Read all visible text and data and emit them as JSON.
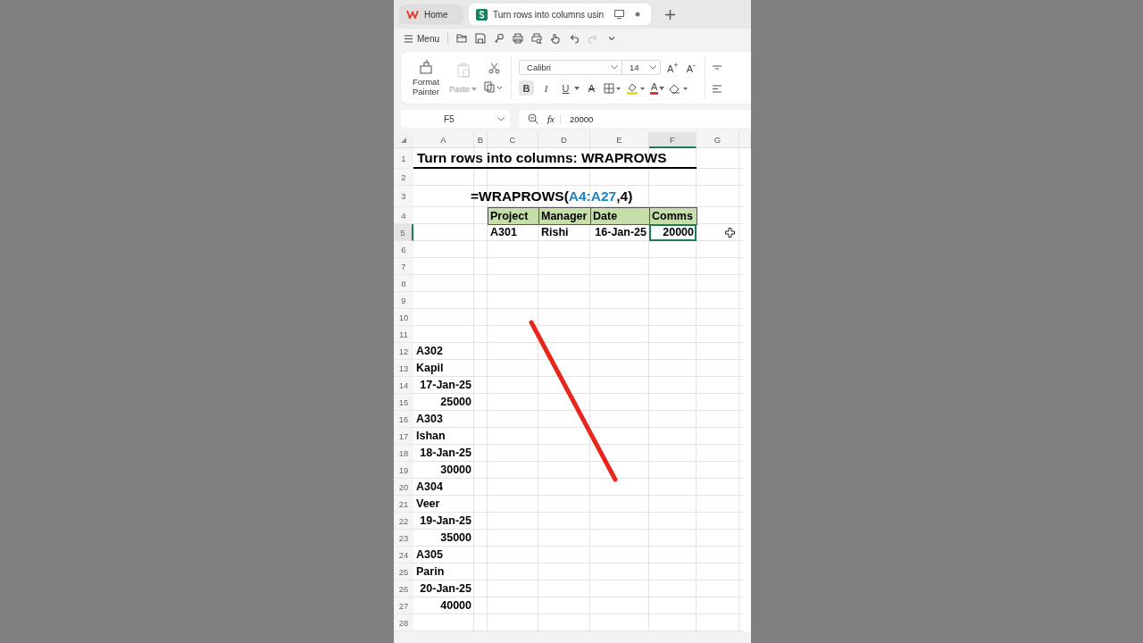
{
  "tabs": [
    {
      "label": "Home",
      "kind": "home",
      "selected": false
    },
    {
      "label": "Turn rows into columns usin",
      "kind": "sheet",
      "selected": true
    }
  ],
  "menu": {
    "label": "Menu"
  },
  "quick_tools": [
    {
      "kind": "open",
      "disabled": false
    },
    {
      "kind": "save",
      "disabled": false
    },
    {
      "kind": "key",
      "disabled": false
    },
    {
      "kind": "print",
      "disabled": false
    },
    {
      "kind": "preview",
      "disabled": false
    },
    {
      "kind": "hand",
      "disabled": false
    },
    {
      "kind": "undo",
      "disabled": false
    },
    {
      "kind": "redo",
      "disabled": true
    },
    {
      "kind": "more",
      "disabled": false
    }
  ],
  "ribbon": {
    "format_painter": "Format Painter",
    "paste": {
      "label": "Paste",
      "disabled": true
    },
    "font": "Calibri",
    "size": "14",
    "grow_font": "A$^{+}$",
    "shrink_font": "A$^{-}$",
    "format_buttons": [
      {
        "label": "B",
        "kind": "bold",
        "selected": true
      },
      {
        "label": "I",
        "kind": "italic",
        "selected": false
      },
      {
        "label": "U",
        "kind": "underline",
        "selected": false
      },
      {
        "label": "A",
        "kind": "strike",
        "selected": false
      }
    ],
    "font_color": {
      "label": "A",
      "color": "#e03030"
    },
    "fill_color": {
      "color": "#f5e000"
    }
  },
  "formula_bar": {
    "name_box": "F5",
    "fx": "fx",
    "value": "20000"
  },
  "sheet": {
    "columns": [
      {
        "label": "A",
        "selected": false
      },
      {
        "label": "B",
        "selected": false
      },
      {
        "label": "C",
        "selected": false
      },
      {
        "label": "D",
        "selected": false
      },
      {
        "label": "E",
        "selected": false
      },
      {
        "label": "F",
        "selected": true
      },
      {
        "label": "G",
        "selected": false
      }
    ],
    "rows": [
      {
        "label": "1",
        "selected": false
      },
      {
        "label": "2",
        "selected": false
      },
      {
        "label": "3",
        "selected": false
      },
      {
        "label": "4",
        "selected": false
      },
      {
        "label": "5",
        "selected": true
      },
      {
        "label": "6",
        "selected": false
      },
      {
        "label": "7",
        "selected": false
      },
      {
        "label": "8",
        "selected": false
      },
      {
        "label": "9",
        "selected": false
      },
      {
        "label": "10",
        "selected": false
      },
      {
        "label": "11",
        "selected": false
      },
      {
        "label": "12",
        "selected": false
      },
      {
        "label": "13",
        "selected": false
      },
      {
        "label": "14",
        "selected": false
      },
      {
        "label": "15",
        "selected": false
      },
      {
        "label": "16",
        "selected": false
      },
      {
        "label": "17",
        "selected": false
      },
      {
        "label": "18",
        "selected": false
      },
      {
        "label": "19",
        "selected": false
      },
      {
        "label": "20",
        "selected": false
      },
      {
        "label": "21",
        "selected": false
      },
      {
        "label": "22",
        "selected": false
      },
      {
        "label": "23",
        "selected": false
      },
      {
        "label": "24",
        "selected": false
      },
      {
        "label": "25",
        "selected": false
      },
      {
        "label": "26",
        "selected": false
      },
      {
        "label": "27",
        "selected": false
      },
      {
        "label": "28",
        "selected": false
      }
    ],
    "title": "Turn rows into columns: WRAPROWS",
    "formula": [
      {
        "text": "=WRAPROWS(",
        "kind": "plain"
      },
      {
        "text": "A4:A27",
        "kind": "reference"
      },
      {
        "text": ",4)",
        "kind": "plain"
      }
    ],
    "table": {
      "headers": [
        "Project",
        "Manager",
        "Date",
        "Comms"
      ],
      "rows": [
        {
          "cells": [
            {
              "text": "A301",
              "kind": "text",
              "selected": false
            },
            {
              "text": "Rishi",
              "kind": "text",
              "selected": false
            },
            {
              "text": "16-Jan-25",
              "kind": "date",
              "selected": false
            },
            {
              "text": "20000",
              "kind": "number",
              "selected": true
            }
          ]
        }
      ]
    },
    "source_values": [
      {
        "text": "A302",
        "kind": "text"
      },
      {
        "text": "Kapil",
        "kind": "text"
      },
      {
        "text": "17-Jan-25",
        "kind": "date"
      },
      {
        "text": "25000",
        "kind": "number"
      },
      {
        "text": "A303",
        "kind": "text"
      },
      {
        "text": "Ishan",
        "kind": "text"
      },
      {
        "text": "18-Jan-25",
        "kind": "date"
      },
      {
        "text": "30000",
        "kind": "number"
      },
      {
        "text": "A304",
        "kind": "text"
      },
      {
        "text": "Veer",
        "kind": "text"
      },
      {
        "text": "19-Jan-25",
        "kind": "date"
      },
      {
        "text": "35000",
        "kind": "number"
      },
      {
        "text": "A305",
        "kind": "text"
      },
      {
        "text": "Parin",
        "kind": "text"
      },
      {
        "text": "20-Jan-25",
        "kind": "date"
      },
      {
        "text": "40000",
        "kind": "number"
      }
    ]
  }
}
